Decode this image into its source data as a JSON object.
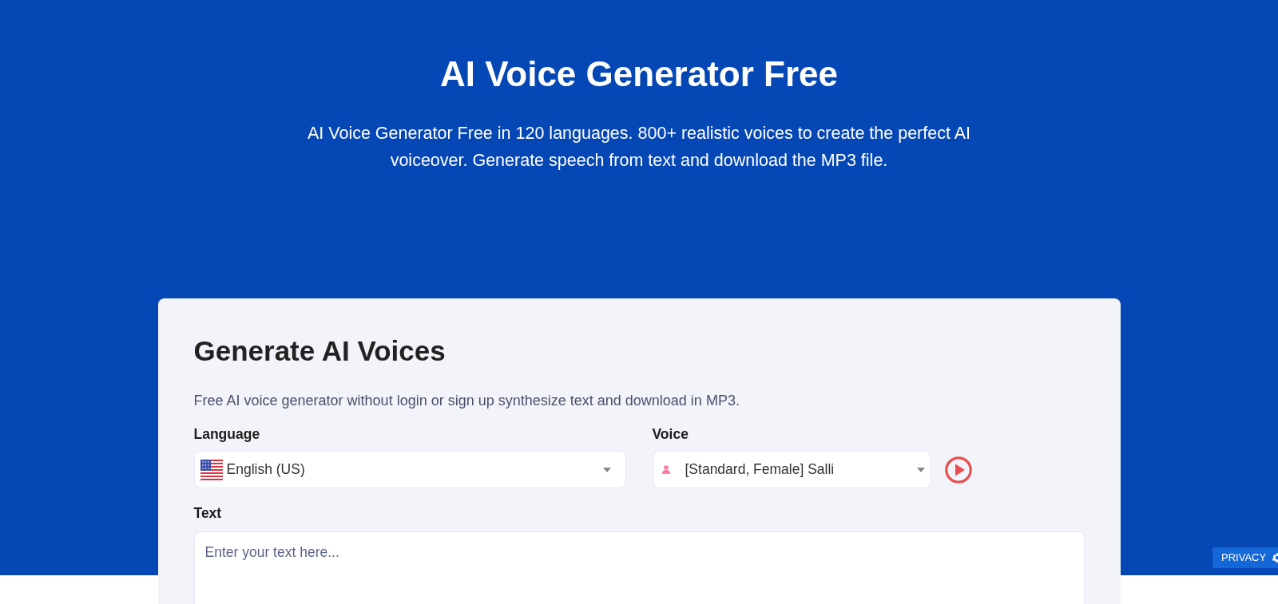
{
  "hero": {
    "title": "AI Voice Generator Free",
    "subtitle": "AI Voice Generator Free in 120 languages. 800+ realistic voices to create the perfect AI voiceover. Generate speech from text and download the MP3 file."
  },
  "card": {
    "title": "Generate AI Voices",
    "description": "Free AI voice generator without login or sign up synthesize text and download in MP3.",
    "fields": [
      {
        "kind": "language",
        "label": "Language",
        "value": "English (US)"
      },
      {
        "kind": "voice",
        "label": "Voice",
        "value": "[Standard, Female] Salli"
      },
      {
        "kind": "text",
        "label": "Text",
        "placeholder": "Enter your text here..."
      }
    ]
  },
  "privacy_button": {
    "label": "PRIVACY"
  }
}
